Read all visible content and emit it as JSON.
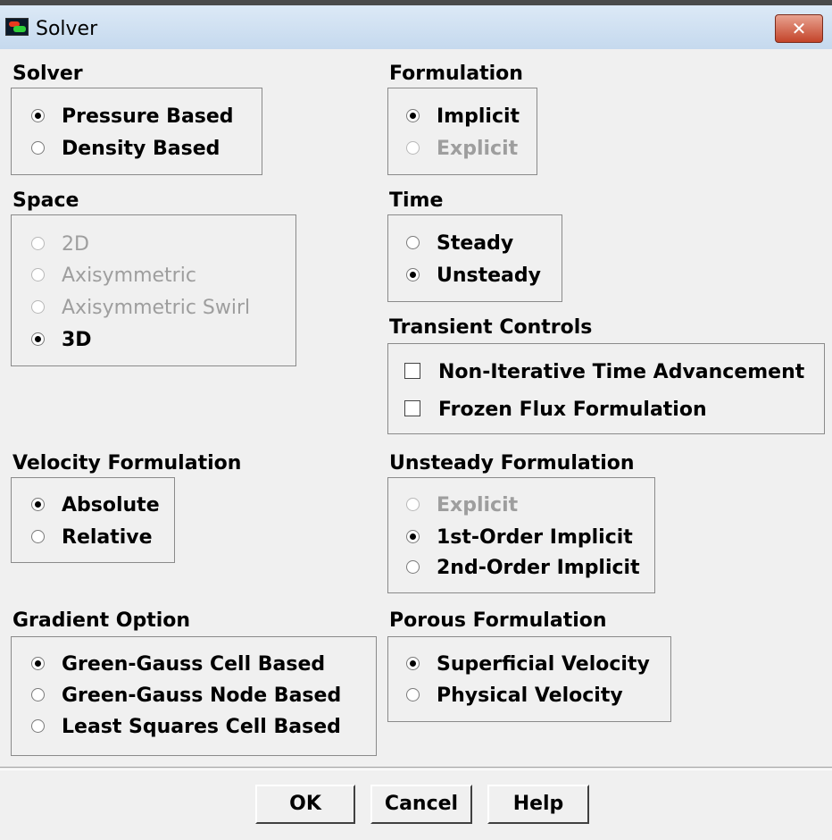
{
  "window": {
    "title": "Solver",
    "close_icon": "close-icon"
  },
  "solver": {
    "label": "Solver",
    "options": [
      "Pressure Based",
      "Density Based"
    ],
    "selected": "Pressure Based"
  },
  "formulation": {
    "label": "Formulation",
    "options": [
      "Implicit",
      "Explicit"
    ],
    "selected": "Implicit",
    "disabled": [
      "Explicit"
    ]
  },
  "space": {
    "label": "Space",
    "options": [
      "2D",
      "Axisymmetric",
      "Axisymmetric Swirl",
      "3D"
    ],
    "selected": "3D",
    "disabled": [
      "2D",
      "Axisymmetric",
      "Axisymmetric Swirl"
    ]
  },
  "time": {
    "label": "Time",
    "options": [
      "Steady",
      "Unsteady"
    ],
    "selected": "Unsteady"
  },
  "transient_controls": {
    "label": "Transient Controls",
    "options": [
      {
        "label": "Non-Iterative Time Advancement",
        "checked": false
      },
      {
        "label": "Frozen Flux Formulation",
        "checked": false
      }
    ]
  },
  "velocity_formulation": {
    "label": "Velocity Formulation",
    "options": [
      "Absolute",
      "Relative"
    ],
    "selected": "Absolute"
  },
  "unsteady_formulation": {
    "label": "Unsteady Formulation",
    "options": [
      "Explicit",
      "1st-Order Implicit",
      "2nd-Order Implicit"
    ],
    "selected": "1st-Order Implicit",
    "disabled": [
      "Explicit"
    ]
  },
  "gradient_option": {
    "label": "Gradient Option",
    "options": [
      "Green-Gauss Cell Based",
      "Green-Gauss Node Based",
      "Least Squares Cell Based"
    ],
    "selected": "Green-Gauss Cell Based"
  },
  "porous_formulation": {
    "label": "Porous Formulation",
    "options": [
      "Superficial Velocity",
      "Physical Velocity"
    ],
    "selected": "Superficial Velocity"
  },
  "buttons": {
    "ok": "OK",
    "cancel": "Cancel",
    "help": "Help"
  },
  "colors": {
    "titlebar": "#c5d9ee",
    "close_button": "#c4442a",
    "dialog_bg": "#f0f0f0",
    "disabled_text": "#9e9e9e"
  }
}
